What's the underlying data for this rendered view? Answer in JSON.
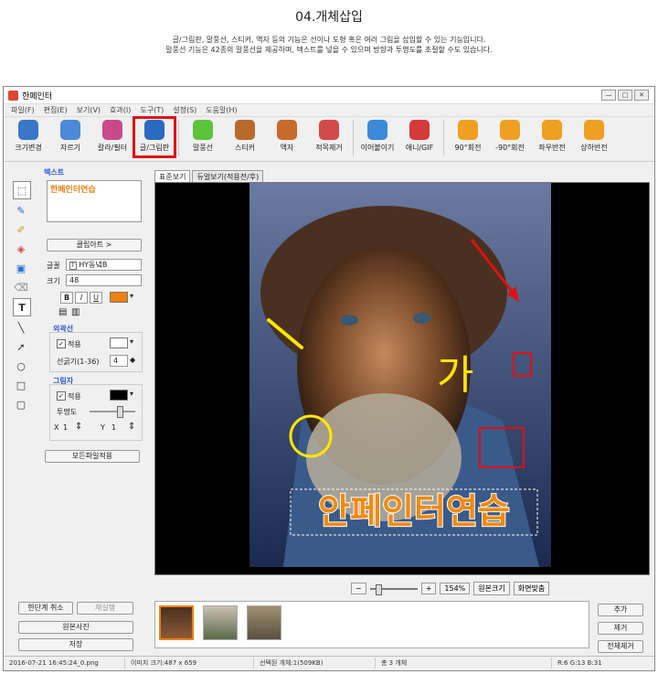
{
  "header": {
    "title": "04.개체삽입",
    "desc_line1": "글/그림판, 말풍선, 스티커, 액자 등의 기능은 선이나 도형 혹은 여러 그림을 삽입할 수 있는 기능입니다.",
    "desc_line2": "말풍선 기능은 42종의 말풍선을 제공하며, 텍스트를 넣을 수 있으며 방향과 투명도를 조절할 수도 있습니다."
  },
  "window": {
    "title": "한페인터",
    "controls": [
      "—",
      "□",
      "✕"
    ]
  },
  "menu": [
    "파일(F)",
    "편집(E)",
    "보기(V)",
    "효과(I)",
    "도구(T)",
    "설정(S)",
    "도움말(H)"
  ],
  "toolbar": [
    {
      "label": "크기변경",
      "color": "#3a77c9"
    },
    {
      "label": "자르기",
      "color": "#4a8ad8"
    },
    {
      "label": "칼라/필터",
      "color": "#c94a8a"
    },
    {
      "label": "글/그림판",
      "color": "#2a6bc0",
      "highlight": true
    },
    {
      "label": "말풍선",
      "color": "#5cc43a"
    },
    {
      "label": "스티커",
      "color": "#b86a2a"
    },
    {
      "label": "액자",
      "color": "#c9692a"
    },
    {
      "label": "적목제거",
      "color": "#d44a4a"
    },
    {
      "label": "이어붙이기",
      "color": "#3a8ad8"
    },
    {
      "label": "애니/GIF",
      "color": "#d43a3a"
    },
    {
      "label": "90°회전",
      "color": "#f0a020"
    },
    {
      "label": "-90°회전",
      "color": "#f0a020"
    },
    {
      "label": "좌우반전",
      "color": "#f0a020"
    },
    {
      "label": "상하반전",
      "color": "#f0a020"
    }
  ],
  "left_panel": {
    "text_section": "텍스트",
    "text_value": "한페인터연습",
    "clipart_button": "클립아트 >",
    "font_label": "글꼴",
    "font_value": "HY동녘B",
    "size_label": "크기",
    "size_value": "48",
    "style_buttons": [
      "B",
      "I",
      "U"
    ],
    "outline_section": "외곽선",
    "outline_apply": "적용",
    "thickness_label": "선굵기(1-36)",
    "thickness_value": "4",
    "shadow_section": "그림자",
    "shadow_apply": "적용",
    "opacity_label": "투명도",
    "x_label": "X",
    "x_value": "1",
    "y_label": "Y",
    "y_value": "1",
    "apply_all_button": "모든파일적용",
    "text_color": "#f08010",
    "outline_color": "#ffffff",
    "shadow_color": "#000000"
  },
  "tabs": [
    "표준보기",
    "듀얼보기(적용전/후)"
  ],
  "canvas": {
    "overlay_text": "안페인터연습",
    "handwritten": "가"
  },
  "zoom": {
    "percent": "154%",
    "original_button": "원본크기",
    "fit_button": "화면맞춤"
  },
  "bottom_left": {
    "undo": "한단계 취소",
    "redo": "재실행",
    "original_photo": "원본사진",
    "save": "저장"
  },
  "bottom_right": {
    "add": "추가",
    "remove": "제거",
    "remove_all": "전체제거"
  },
  "status": {
    "file": "2016-07-21 16:45:24_0.png",
    "size": "이미지 크기:487 x 659",
    "selected": "선택된 개체:1(509KB)",
    "total": "총 3 개체",
    "rgb": "R:6 G:13 B:31"
  }
}
